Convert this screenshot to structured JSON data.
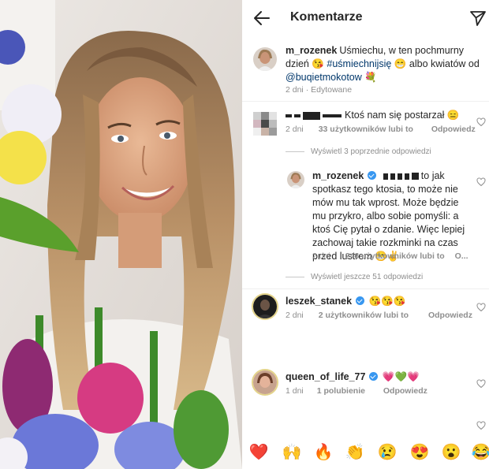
{
  "header": {
    "title": "Komentarze"
  },
  "caption": {
    "username": "m_rozenek",
    "text_line1": "Uśmiechu, w ten pochmurny",
    "text_line2_pre": "dzień 😘 ",
    "hashtag": "#uśmiechnijsię",
    "text_line2_post": " 😁 albo kwiatów od",
    "mention": "@buqietmokotow",
    "emoji_end": " 💐",
    "time": "2 dni",
    "edited": "Edytowane"
  },
  "comments": [
    {
      "username_redacted": true,
      "text": "Ktoś nam się postarzał 😑",
      "time": "2 dni",
      "likes": "33 użytkowników lubi to",
      "reply": "Odpowiedz"
    },
    {
      "view_previous": "Wyświetl 3 poprzednie odpowiedzi"
    },
    {
      "username": "m_rozenek",
      "lines": [
        "to jak",
        "spotkasz tego ktosia, to może nie",
        "mów mu tak wprost. Może będzie",
        "mu przykro, albo sobie pomyśli: a",
        "ktoś Cię pytał o zdanie. Więc lepiej",
        "zachowaj takie rozkminki na czas",
        "przed lustrem 😁✌"
      ],
      "time": "2 dni",
      "likes": "246 użytkowników lubi to",
      "reply": "O..."
    },
    {
      "view_more": "Wyświetl jeszcze 51 odpowiedzi"
    },
    {
      "username": "leszek_stanek",
      "text": "😘😘😘",
      "time": "2 dni",
      "likes": "2 użytkowników lubi to",
      "reply": "Odpowiedz"
    },
    {
      "username": "queen_of_life_77",
      "text": "💗💚💗",
      "time": "1 dni",
      "likes": "1 polubienie",
      "reply": "Odpowiedz"
    }
  ],
  "emoji_bar": [
    "❤️",
    "🙌",
    "🔥",
    "👏",
    "😢",
    "😍",
    "😮",
    "😂"
  ],
  "colors": {
    "link": "#00376b",
    "meta": "#8e8e8e",
    "verified": "#3897f0"
  },
  "icons": [
    "back-arrow-icon",
    "send-icon",
    "heart-icon",
    "verified-icon"
  ]
}
